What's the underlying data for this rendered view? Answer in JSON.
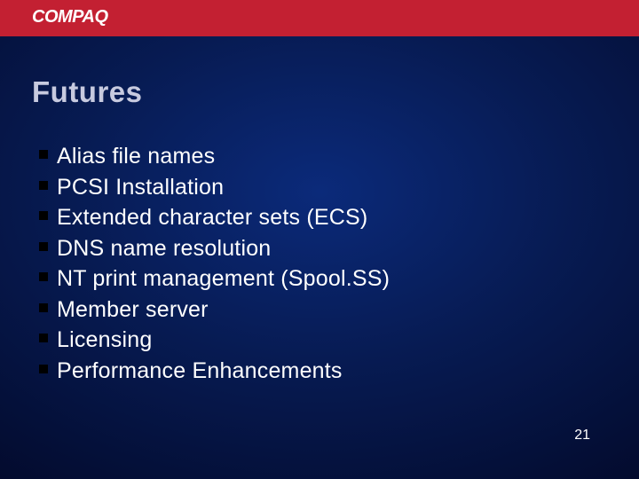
{
  "brand": {
    "name": "COMPAQ"
  },
  "slide": {
    "title": "Futures",
    "bullets": [
      "Alias file names",
      "PCSI Installation",
      "Extended character sets (ECS)",
      "DNS name resolution",
      "NT print management (Spool.SS)",
      "Member server",
      "Licensing",
      "Performance Enhancements"
    ],
    "page_number": "21"
  },
  "colors": {
    "accent_red": "#c32032",
    "title_gray": "#c7cadf"
  }
}
